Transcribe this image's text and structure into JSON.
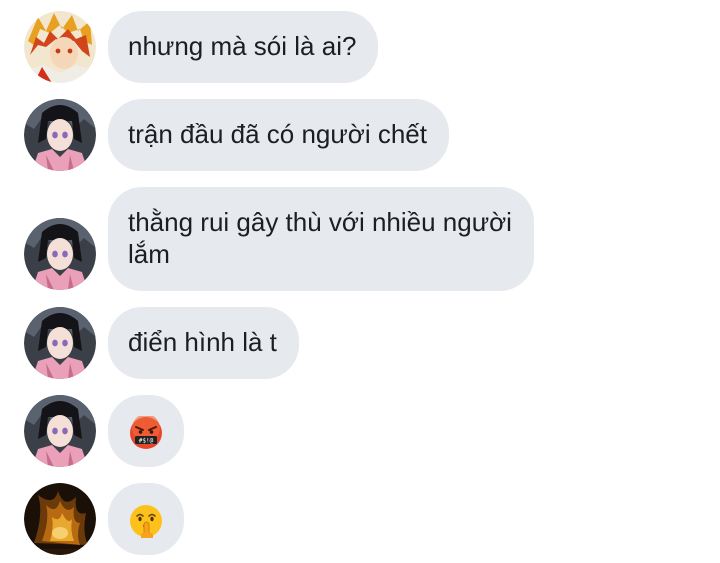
{
  "messages": [
    {
      "sender": "rengoku",
      "text": "nhưng mà sói là ai?"
    },
    {
      "sender": "shinobu",
      "text": "trận đầu đã có người chết"
    },
    {
      "sender": "shinobu",
      "text_line1": "thằng rui gây thù với nhiều người",
      "text_line2": "lắm"
    },
    {
      "sender": "shinobu",
      "text": "điển hình là t"
    },
    {
      "sender": "shinobu",
      "emoji": "cursing-face-emoji"
    },
    {
      "sender": "flame-avatar",
      "emoji": "shushing-face-emoji"
    }
  ],
  "icons": {
    "avatar_rengoku": "rengoku-avatar",
    "avatar_shinobu": "shinobu-avatar",
    "avatar_flame": "flame-avatar"
  },
  "colors": {
    "bubble": "#e6e9ed",
    "text": "#1c1e21",
    "background": "#ffffff"
  }
}
